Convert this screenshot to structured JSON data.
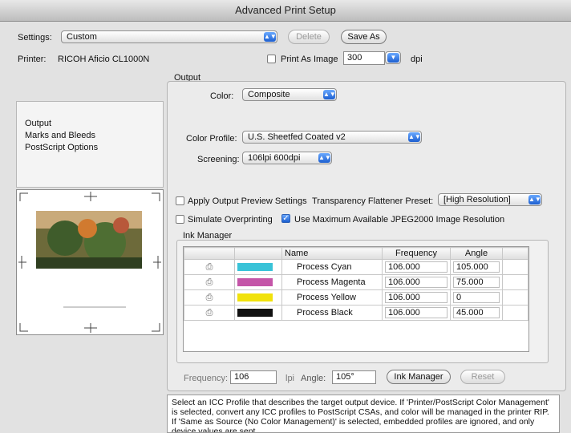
{
  "window": {
    "title": "Advanced Print Setup"
  },
  "settings": {
    "label": "Settings:",
    "value": "Custom",
    "delete_label": "Delete",
    "save_as_label": "Save As"
  },
  "printer": {
    "label": "Printer:",
    "value": "RICOH Aficio CL1000N",
    "print_as_image_label": "Print As Image",
    "dpi_value": "300",
    "dpi_unit": "dpi"
  },
  "sidebar": {
    "items": [
      {
        "label": "Output"
      },
      {
        "label": "Marks and Bleeds"
      },
      {
        "label": "PostScript Options"
      }
    ]
  },
  "output": {
    "section_title": "Output",
    "color_label": "Color:",
    "color_value": "Composite",
    "color_profile_label": "Color Profile:",
    "color_profile_value": "U.S. Sheetfed Coated v2",
    "screening_label": "Screening:",
    "screening_value": "106lpi 600dpi",
    "apply_preview_label": "Apply Output Preview Settings",
    "transparency_label": "Transparency Flattener Preset:",
    "transparency_value": "[High Resolution]",
    "simulate_overprint_label": "Simulate Overprinting",
    "max_jpeg_label": "Use Maximum Available JPEG2000 Image Resolution"
  },
  "ink_manager": {
    "title": "Ink Manager",
    "columns": [
      "Name",
      "Frequency",
      "Angle"
    ],
    "rows": [
      {
        "name": "Process Cyan",
        "frequency": "106.000",
        "angle": "105.000",
        "color": "#39c3d8"
      },
      {
        "name": "Process Magenta",
        "frequency": "106.000",
        "angle": "75.000",
        "color": "#c455a8"
      },
      {
        "name": "Process Yellow",
        "frequency": "106.000",
        "angle": "0",
        "color": "#f1e20c"
      },
      {
        "name": "Process Black",
        "frequency": "106.000",
        "angle": "45.000",
        "color": "#111111"
      }
    ],
    "frequency_label": "Frequency:",
    "frequency_value": "106",
    "lpi_label": "lpi",
    "angle_label": "Angle:",
    "angle_value": "105°",
    "ink_manager_button": "Ink Manager",
    "reset_button": "Reset"
  },
  "help_text": "Select an ICC Profile that describes the target output device. If 'Printer/PostScript Color Management' is selected, convert any ICC profiles to PostScript CSAs, and color will be managed in the printer RIP. If 'Same as Source (No Color Management)' is selected, embedded profiles are ignored, and only device values are sent."
}
